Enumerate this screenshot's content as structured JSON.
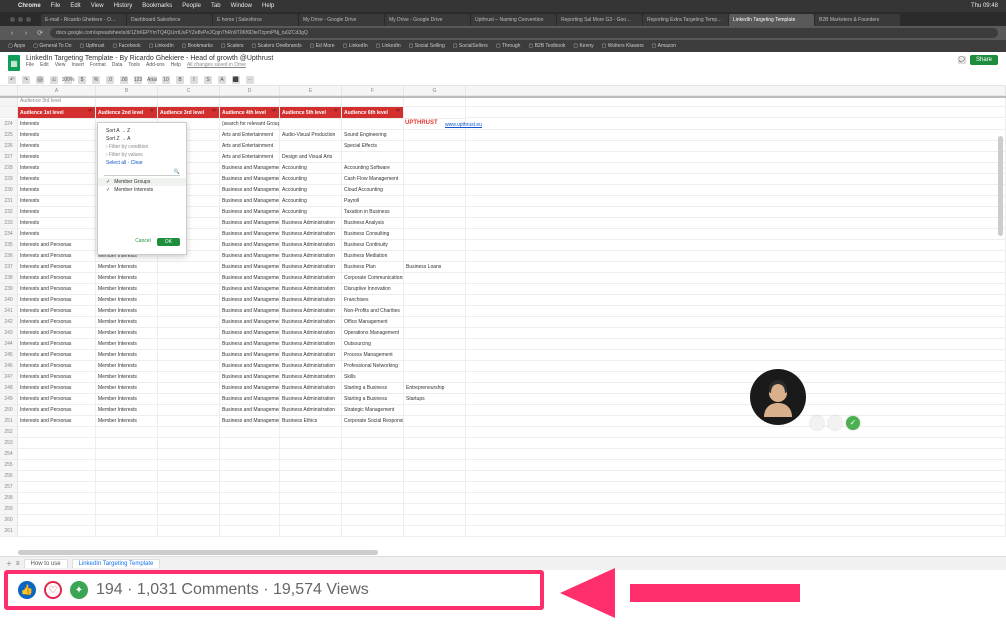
{
  "mac_menu": {
    "apple": "",
    "app": "Chrome",
    "items": [
      "File",
      "Edit",
      "View",
      "History",
      "Bookmarks",
      "People",
      "Tab",
      "Window",
      "Help"
    ],
    "clock": "Thu 09:48"
  },
  "tabs": [
    "E-mail - Ricardo Ghekiere - O…",
    "Dashboard Salesforce",
    "E home | Salesforce",
    "My Drive - Google Drive",
    "My Drive - Google Drive",
    "Upthrust – Naming Convention",
    "Reporting Sal More G3 - Goo…",
    "Reporting Extra Targeting Temp…",
    "LinkedIn Targeting Template",
    "B2B Marketers & Founders"
  ],
  "active_tab_index": 8,
  "url": "docs.google.com/spreadsheets/d/1ZhKEPYmTQ4QLlrrtUuFYZe8vPeJCpjn7hRn9T0Kf6Dtel7zpmPNj_tu0ZCd3gQ",
  "bookmarks": [
    "Apps",
    "General To Do",
    "Upthrust",
    "Facebook",
    "LinkedIn",
    "Bookmarks",
    "Scalers",
    "Scalers Onelbrands",
    "Ed More",
    "LinkedIn",
    "LinkedIn",
    "Social Selling",
    "SocialSellers",
    "Through",
    "B2B Textbook",
    "Kenny",
    "Wolters Kluwers",
    "Amazon"
  ],
  "doc": {
    "title": "LinkedIn Targeting Template - By Ricardo Ghekiere - Head of growth @Upthrust",
    "menus": [
      "File",
      "Edit",
      "View",
      "Insert",
      "Format",
      "Data",
      "Tools",
      "Add-ons",
      "Help"
    ],
    "saved": "All changes saved in Drive",
    "share": "Share"
  },
  "toolbar_icons": [
    "↶",
    "↷",
    "🖨",
    "⎌",
    "100%",
    "$",
    "%",
    ".0",
    ".00",
    "123",
    "Arial",
    "10",
    "B",
    "I",
    "S",
    "A",
    "⬛",
    "⋯"
  ],
  "frozen_label": "Audience 3rd level",
  "columns": [
    "",
    "A",
    "B",
    "C",
    "D",
    "E",
    "F",
    "G",
    ""
  ],
  "headers": [
    "",
    "Audience 1st level",
    "Audience 2nd level",
    "Audience 3rd level",
    "Audience 4th level",
    "Audience 5th level",
    "Audience 6th level",
    ""
  ],
  "upthrust": {
    "logo": "UPTHRUST",
    "url": "www.upthrust.eu"
  },
  "filter": {
    "sort_az": "Sort A → Z",
    "sort_za": "Sort Z → A",
    "cond": "› Filter by condition",
    "vals": "› Filter by values",
    "links": "Select all · Clear",
    "opt1": "Member Groups",
    "opt2": "Member Interests",
    "cancel": "Cancel",
    "ok": "OK"
  },
  "rows": [
    [
      "Interests",
      "",
      "",
      "(search for relevant Group Members)",
      "",
      "",
      ""
    ],
    [
      "Interests",
      "",
      "",
      "Arts and Entertainment",
      "Audio-Visual Production",
      "Sound Engineering",
      ""
    ],
    [
      "Interests",
      "",
      "",
      "Arts and Entertainment",
      "",
      "Special Effects",
      ""
    ],
    [
      "Interests",
      "",
      "",
      "Arts and Entertainment",
      "Design and Visual Arts",
      "",
      ""
    ],
    [
      "Interests",
      "",
      "",
      "Business and Management",
      "Accounting",
      "Accounting Software",
      ""
    ],
    [
      "Interests",
      "",
      "",
      "Business and Management",
      "Accounting",
      "Cash Flow Management",
      ""
    ],
    [
      "Interests",
      "",
      "",
      "Business and Management",
      "Accounting",
      "Cloud Accounting",
      ""
    ],
    [
      "Interests",
      "",
      "",
      "Business and Management",
      "Accounting",
      "Payroll",
      ""
    ],
    [
      "Interests",
      "",
      "",
      "Business and Management",
      "Accounting",
      "Taxation in Business",
      ""
    ],
    [
      "Interests",
      "",
      "",
      "Business and Management",
      "Business Administration",
      "Business Analysis",
      ""
    ],
    [
      "Interests",
      "",
      "",
      "Business and Management",
      "Business Administration",
      "Business Consulting",
      ""
    ],
    [
      "Interests and Personas",
      "Member Interests",
      "",
      "Business and Management",
      "Business Administration",
      "Business Continuity",
      ""
    ],
    [
      "Interests and Personas",
      "Member Interests",
      "",
      "Business and Management",
      "Business Administration",
      "Business Mediation",
      ""
    ],
    [
      "Interests and Personas",
      "Member Interests",
      "",
      "Business and Management",
      "Business Administration",
      "Business Plan",
      "Business Loans"
    ],
    [
      "Interests and Personas",
      "Member Interests",
      "",
      "Business and Management",
      "Business Administration",
      "Corporate Communications",
      ""
    ],
    [
      "Interests and Personas",
      "Member Interests",
      "",
      "Business and Management",
      "Business Administration",
      "Disruptive Innovation",
      ""
    ],
    [
      "Interests and Personas",
      "Member Interests",
      "",
      "Business and Management",
      "Business Administration",
      "Franchises",
      ""
    ],
    [
      "Interests and Personas",
      "Member Interests",
      "",
      "Business and Management",
      "Business Administration",
      "Non-Profits and Charities",
      ""
    ],
    [
      "Interests and Personas",
      "Member Interests",
      "",
      "Business and Management",
      "Business Administration",
      "Office Management",
      ""
    ],
    [
      "Interests and Personas",
      "Member Interests",
      "",
      "Business and Management",
      "Business Administration",
      "Operations Management",
      ""
    ],
    [
      "Interests and Personas",
      "Member Interests",
      "",
      "Business and Management",
      "Business Administration",
      "Outsourcing",
      ""
    ],
    [
      "Interests and Personas",
      "Member Interests",
      "",
      "Business and Management",
      "Business Administration",
      "Process Management",
      ""
    ],
    [
      "Interests and Personas",
      "Member Interests",
      "",
      "Business and Management",
      "Business Administration",
      "Professional Networking",
      ""
    ],
    [
      "Interests and Personas",
      "Member Interests",
      "",
      "Business and Management",
      "Business Administration",
      "Skills",
      ""
    ],
    [
      "Interests and Personas",
      "Member Interests",
      "",
      "Business and Management",
      "Business Administration",
      "Starting a Business",
      "Entrepreneurship"
    ],
    [
      "Interests and Personas",
      "Member Interests",
      "",
      "Business and Management",
      "Business Administration",
      "Starting a Business",
      "Startups"
    ],
    [
      "Interests and Personas",
      "Member Interests",
      "",
      "Business and Management",
      "Business Administration",
      "Strategic Management",
      ""
    ],
    [
      "Interests and Personas",
      "Member Interests",
      "",
      "Business and Management",
      "Business Ethics",
      "Corporate Social Responsibility",
      ""
    ]
  ],
  "first_row_number": 224,
  "sheet_tabs": {
    "howto": "How to use",
    "active": "LinkedIn Targeting Template"
  },
  "reactions": {
    "count": "194",
    "comments": "1,031 Comments",
    "views": "19,574 Views",
    "sep": " · "
  }
}
